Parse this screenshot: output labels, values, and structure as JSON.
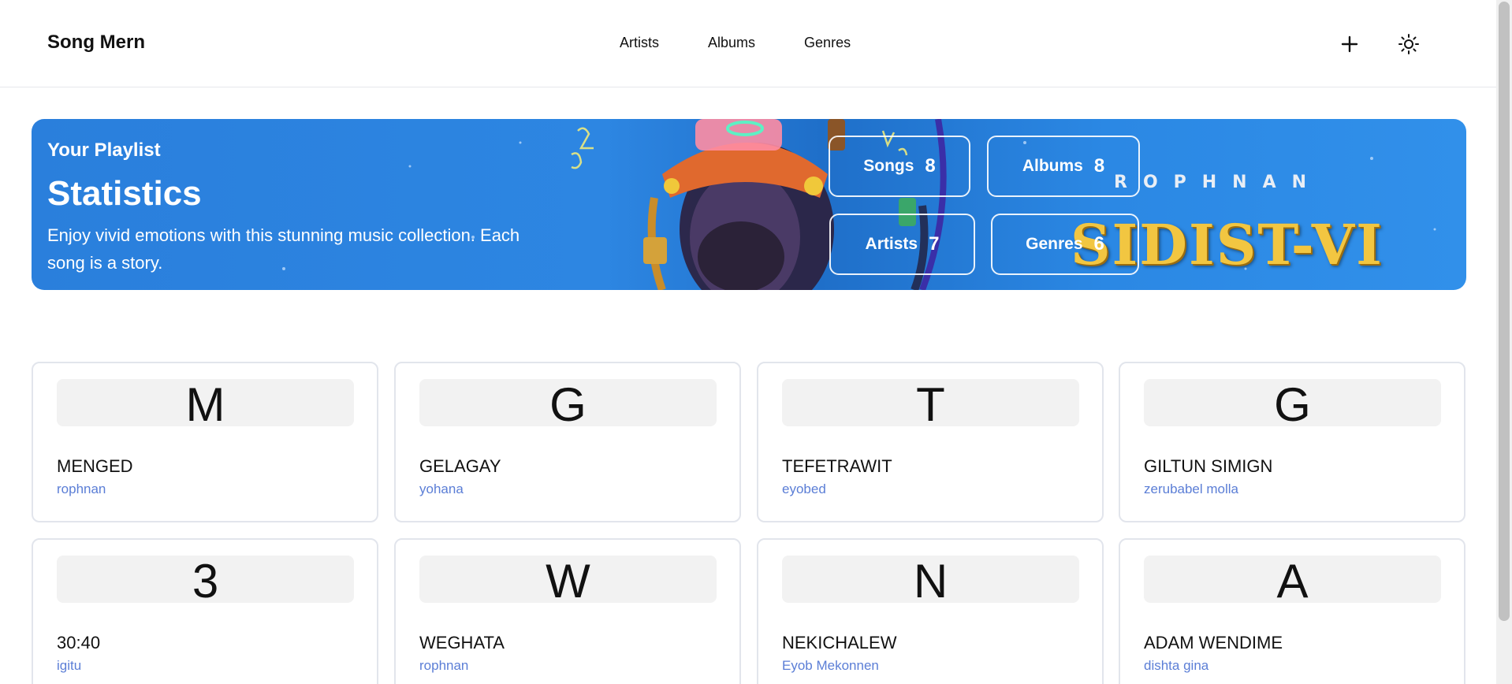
{
  "header": {
    "brand": "Song Mern",
    "nav": [
      {
        "label": "Artists"
      },
      {
        "label": "Albums"
      },
      {
        "label": "Genres"
      }
    ],
    "add_icon": "plus-icon",
    "theme_icon": "sun-icon"
  },
  "banner": {
    "subtitle": "Your Playlist",
    "title": "Statistics",
    "description": "Enjoy vivid emotions with this stunning music collection. Each song is a story.",
    "stats": {
      "songs": {
        "label": "Songs",
        "value": "8"
      },
      "albums": {
        "label": "Albums",
        "value": "8"
      },
      "artists": {
        "label": "Artists",
        "value": "7"
      },
      "genres": {
        "label": "Genres",
        "value": "6"
      }
    },
    "artwork_artist": "ROPHNAN",
    "artwork_album": "SIDIST-VI"
  },
  "songs": [
    {
      "letter": "M",
      "title": "MENGED",
      "artist": "rophnan"
    },
    {
      "letter": "G",
      "title": "GELAGAY",
      "artist": "yohana"
    },
    {
      "letter": "T",
      "title": "TEFETRAWIT",
      "artist": "eyobed"
    },
    {
      "letter": "G",
      "title": "GILTUN SIMIGN",
      "artist": "zerubabel molla"
    },
    {
      "letter": "3",
      "title": "30:40",
      "artist": "igitu"
    },
    {
      "letter": "W",
      "title": "WEGHATA",
      "artist": "rophnan"
    },
    {
      "letter": "N",
      "title": "NEKICHALEW",
      "artist": "Eyob Mekonnen"
    },
    {
      "letter": "A",
      "title": "ADAM WENDIME",
      "artist": "dishta gina"
    }
  ],
  "colors": {
    "banner_blue": "#2a7fdc",
    "artist_link": "#5b7ed6",
    "album_gold": "#f2c641"
  }
}
